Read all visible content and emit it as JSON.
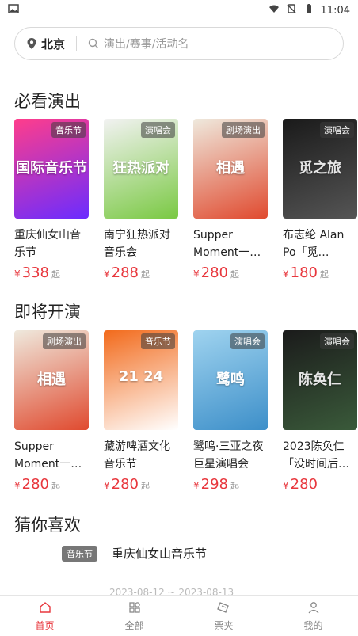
{
  "status": {
    "time": "11:04"
  },
  "search": {
    "city": "北京",
    "placeholder": "演出/赛事/活动名"
  },
  "sections": {
    "must_see": {
      "title": "必看演出",
      "cards": [
        {
          "name": "重庆仙女山音乐节",
          "tag": "音乐节",
          "price": "338",
          "price_unit": "起",
          "poster_text": "国际音乐节",
          "poster_colors": [
            "#ff3d8b",
            "#6b2cff"
          ]
        },
        {
          "name": "南宁狂热派对音乐会",
          "tag": "演唱会",
          "price": "288",
          "price_unit": "起",
          "poster_text": "狂热派对",
          "poster_colors": [
            "#f2f2f2",
            "#7ac943"
          ]
        },
        {
          "name": "Supper Moment一…",
          "tag": "剧场演出",
          "price": "280",
          "price_unit": "起",
          "poster_text": "相遇",
          "poster_colors": [
            "#efe9dd",
            "#e04a2f"
          ]
        },
        {
          "name": "布志纶 Alan Po「觅…",
          "tag": "演唱会",
          "price": "180",
          "price_unit": "起",
          "poster_text": "觅之旅",
          "poster_colors": [
            "#1a1a1a",
            "#555555"
          ]
        }
      ]
    },
    "upcoming": {
      "title": "即将开演",
      "cards": [
        {
          "name": "Supper Moment一…",
          "tag": "剧场演出",
          "price": "280",
          "price_unit": "起",
          "poster_text": "相遇",
          "poster_colors": [
            "#efe9dd",
            "#e04a2f"
          ]
        },
        {
          "name": "藏游啤酒文化音乐节",
          "tag": "音乐节",
          "price": "280",
          "price_unit": "起",
          "poster_text": "21 24",
          "poster_colors": [
            "#f26a1b",
            "#ffffff"
          ]
        },
        {
          "name": "鹭鸣·三亚之夜巨星演唱会",
          "tag": "演唱会",
          "price": "298",
          "price_unit": "起",
          "poster_text": "鹭鸣",
          "poster_colors": [
            "#9fd3ef",
            "#3d8fc9"
          ]
        },
        {
          "name": "2023陈奂仁「没时间后…",
          "tag": "演唱会",
          "price": "280",
          "price_unit": "",
          "poster_text": "陈奂仁",
          "poster_colors": [
            "#1b1b1b",
            "#3a5a3a"
          ]
        }
      ]
    },
    "guess": {
      "title": "猜你喜欢",
      "item": {
        "tag": "音乐节",
        "title": "重庆仙女山音乐节",
        "date": "2023-08-12 ~ 2023-08-13"
      }
    }
  },
  "currency": "¥",
  "tabbar": [
    {
      "label": "首页",
      "icon": "home-icon",
      "active": true
    },
    {
      "label": "全部",
      "icon": "grid-icon",
      "active": false
    },
    {
      "label": "票夹",
      "icon": "ticket-icon",
      "active": false
    },
    {
      "label": "我的",
      "icon": "user-icon",
      "active": false
    }
  ],
  "colors": {
    "accent": "#e8373d",
    "tag_bg": "#777777"
  }
}
